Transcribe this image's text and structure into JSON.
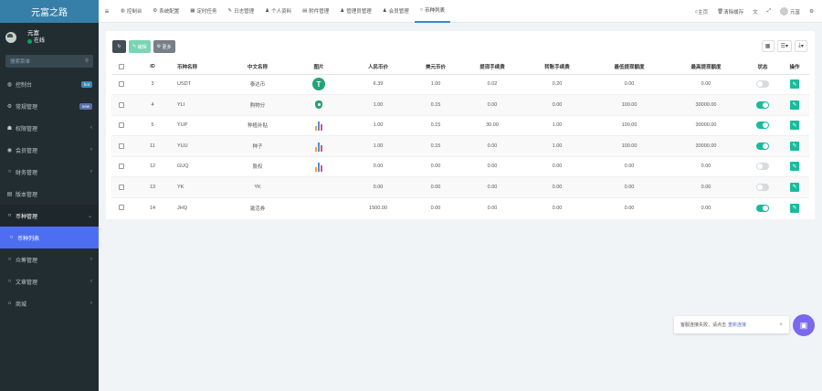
{
  "app": {
    "brand": "元富之路"
  },
  "user": {
    "name": "元富",
    "status": "在线"
  },
  "sidebar": {
    "search_placeholder": "搜索菜单",
    "items": [
      {
        "icon": "dashboard-icon",
        "glyph": "◍",
        "label": "控制台",
        "badge": "hot"
      },
      {
        "icon": "cogs-icon",
        "glyph": "⚙",
        "label": "常规管理",
        "badge": "new"
      },
      {
        "icon": "group-icon",
        "glyph": "☗",
        "label": "权限管理",
        "chev": "‹"
      },
      {
        "icon": "user-circle-icon",
        "glyph": "◉",
        "label": "会员管理",
        "chev": "‹"
      },
      {
        "icon": "circle-icon",
        "glyph": "○",
        "label": "财务管理",
        "chev": "‹"
      },
      {
        "icon": "file-icon",
        "glyph": "▤",
        "label": "版本管理"
      },
      {
        "icon": "circle-icon",
        "glyph": "○",
        "label": "币种管理",
        "chev": "⌄",
        "open": true
      },
      {
        "icon": "circle-icon",
        "glyph": "○",
        "label": "币种列表",
        "sub": true
      },
      {
        "icon": "circle-icon",
        "glyph": "○",
        "label": "众筹管理",
        "chev": "‹"
      },
      {
        "icon": "circle-icon",
        "glyph": "○",
        "label": "文章管理",
        "chev": "‹"
      },
      {
        "icon": "home-icon",
        "glyph": "⌂",
        "label": "商城",
        "chev": "‹"
      }
    ]
  },
  "tabs": [
    {
      "icon": "dashboard-icon",
      "glyph": "◍",
      "label": "控制台"
    },
    {
      "icon": "cog-icon",
      "glyph": "⚙",
      "label": "系统配置"
    },
    {
      "icon": "calendar-icon",
      "glyph": "▦",
      "label": "定时任务"
    },
    {
      "icon": "log-icon",
      "glyph": "✎",
      "label": "日志管理"
    },
    {
      "icon": "user-icon",
      "glyph": "♟",
      "label": "个人资料"
    },
    {
      "icon": "file-icon",
      "glyph": "▤",
      "label": "附件管理"
    },
    {
      "icon": "user-icon",
      "glyph": "♟",
      "label": "管理员管理"
    },
    {
      "icon": "user-icon",
      "glyph": "♟",
      "label": "会员管理"
    },
    {
      "icon": "circle-icon",
      "glyph": "○",
      "label": "币种列表",
      "active": true
    }
  ],
  "top_right": {
    "home": "主页",
    "clear_cache": "清除缓存",
    "username": "元富"
  },
  "toolbar": {
    "edit_label": "编辑",
    "more_label": "更多"
  },
  "table": {
    "columns": [
      "ID",
      "币种名称",
      "中文名称",
      "图片",
      "人民币价",
      "美元币价",
      "提现手续费",
      "转账手续费",
      "最低提现额度",
      "最高提现额度",
      "状态",
      "操作"
    ],
    "rows": [
      {
        "id": "3",
        "name": "USDT",
        "cn": "泰达币",
        "img": "usdt",
        "cny": "6.39",
        "usd": "1.00",
        "wfee": "0.02",
        "tfee": "0.20",
        "min": "0.00",
        "max": "0.00",
        "status": false
      },
      {
        "id": "4",
        "name": "YLI",
        "cn": "购物分",
        "img": "yli",
        "cny": "1.00",
        "usd": "0.15",
        "wfee": "0.00",
        "tfee": "0.00",
        "min": "100.00",
        "max": "30000.00",
        "status": true
      },
      {
        "id": "5",
        "name": "YUP",
        "cn": "种植补贴",
        "img": "bars",
        "cny": "1.00",
        "usd": "0.15",
        "wfee": "30.00",
        "tfee": "1.00",
        "min": "100.00",
        "max": "30000.00",
        "status": true
      },
      {
        "id": "11",
        "name": "YUU",
        "cn": "种子",
        "img": "bars",
        "cny": "1.00",
        "usd": "0.15",
        "wfee": "0.00",
        "tfee": "1.00",
        "min": "100.00",
        "max": "30000.00",
        "status": true
      },
      {
        "id": "12",
        "name": "GUQ",
        "cn": "股权",
        "img": "bars",
        "cny": "0.00",
        "usd": "0.00",
        "wfee": "0.00",
        "tfee": "0.00",
        "min": "0.00",
        "max": "0.00",
        "status": false
      },
      {
        "id": "13",
        "name": "YK",
        "cn": "YK",
        "img": "",
        "cny": "0.00",
        "usd": "0.00",
        "wfee": "0.00",
        "tfee": "0.00",
        "min": "0.00",
        "max": "0.00",
        "status": false
      },
      {
        "id": "14",
        "name": "JHQ",
        "cn": "激活券",
        "img": "",
        "cny": "1500.00",
        "usd": "0.00",
        "wfee": "0.00",
        "tfee": "0.00",
        "min": "0.00",
        "max": "0.00",
        "status": true
      }
    ]
  },
  "toast": {
    "message": "客服连接失败，请点击",
    "link": "重新连接",
    "close": "×"
  },
  "colors": {
    "sidebar_bg": "#222d32",
    "brand_bg": "#367fa9",
    "accent": "#18bc9c",
    "active_menu": "#4e6ef2"
  }
}
